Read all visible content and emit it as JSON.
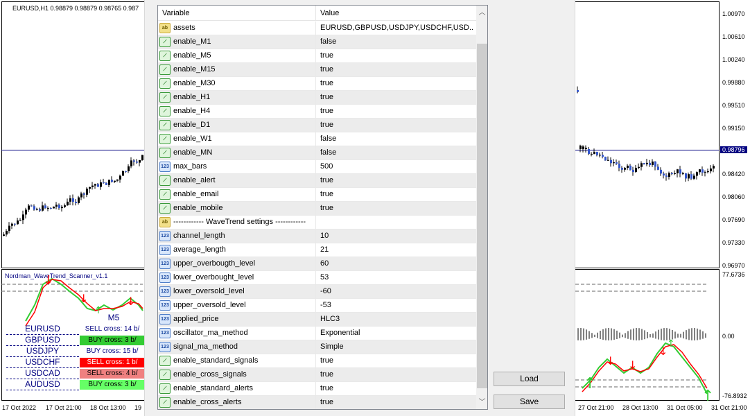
{
  "chart": {
    "title": "EURUSD,H1  0.98879 0.98879 0.98765 0.987",
    "indicator_title": "Nordman_WaveTrend_Scanner_v1.1",
    "price_labels": [
      "1.00970",
      "1.00610",
      "1.00240",
      "0.99880",
      "0.99510",
      "0.99150",
      "0.98796",
      "0.98420",
      "0.98060",
      "0.97690",
      "0.97330",
      "0.96970"
    ],
    "current_price": "0.98796",
    "indicator_labels": [
      "77.6736",
      "0.00",
      "-76.8932"
    ],
    "time_labels": [
      "17 Oct 2022",
      "17 Oct 21:00",
      "18 Oct 13:00",
      "19",
      "27 Oct 21:00",
      "28 Oct 13:00",
      "31 Oct 05:00",
      "31 Oct 21:00"
    ]
  },
  "scanner": {
    "timeframe": "M5",
    "rows": [
      {
        "symbol": "EURUSD",
        "signal": "SELL cross: 14 b/",
        "style": "plain"
      },
      {
        "symbol": "GBPUSD",
        "signal": "BUY cross: 3 b/",
        "style": "green"
      },
      {
        "symbol": "USDJPY",
        "signal": "BUY cross: 15 b/",
        "style": "plain"
      },
      {
        "symbol": "USDCHF",
        "signal": "SELL cross: 1 b/",
        "style": "red"
      },
      {
        "symbol": "USDCAD",
        "signal": "SELL cross: 4 b/",
        "style": "lightred"
      },
      {
        "symbol": "AUDUSD",
        "signal": "BUY cross: 3 b/",
        "style": "lightgreen"
      }
    ]
  },
  "colors": {
    "green": "#33cc33",
    "red": "#ff0000",
    "lightred": "#f08080",
    "lightgreen": "#66ff66"
  },
  "dialog": {
    "header": {
      "variable": "Variable",
      "value": "Value"
    },
    "rows": [
      {
        "name": "assets",
        "value": "EURUSD,GBPUSD,USDJPY,USDCHF,USD...",
        "icon": "ab"
      },
      {
        "name": "enable_M1",
        "value": "false",
        "icon": "bool"
      },
      {
        "name": "enable_M5",
        "value": "true",
        "icon": "bool"
      },
      {
        "name": "enable_M15",
        "value": "true",
        "icon": "bool"
      },
      {
        "name": "enable_M30",
        "value": "true",
        "icon": "bool"
      },
      {
        "name": "enable_H1",
        "value": "true",
        "icon": "bool"
      },
      {
        "name": "enable_H4",
        "value": "true",
        "icon": "bool"
      },
      {
        "name": "enable_D1",
        "value": "true",
        "icon": "bool"
      },
      {
        "name": "enable_W1",
        "value": "false",
        "icon": "bool"
      },
      {
        "name": "enable_MN",
        "value": "false",
        "icon": "bool"
      },
      {
        "name": "max_bars",
        "value": "500",
        "icon": "num"
      },
      {
        "name": "enable_alert",
        "value": "true",
        "icon": "bool"
      },
      {
        "name": "enable_email",
        "value": "true",
        "icon": "bool"
      },
      {
        "name": "enable_mobile",
        "value": "true",
        "icon": "bool"
      },
      {
        "name": "------------ WaveTrend settings ------------",
        "value": "",
        "icon": "ab"
      },
      {
        "name": "channel_length",
        "value": "10",
        "icon": "num"
      },
      {
        "name": "average_length",
        "value": "21",
        "icon": "num"
      },
      {
        "name": "upper_overbougth_level",
        "value": "60",
        "icon": "num"
      },
      {
        "name": "lower_overbought_level",
        "value": "53",
        "icon": "num"
      },
      {
        "name": "lower_oversold_level",
        "value": "-60",
        "icon": "num"
      },
      {
        "name": "upper_oversold_level",
        "value": "-53",
        "icon": "num"
      },
      {
        "name": "applied_price",
        "value": "HLC3",
        "icon": "num"
      },
      {
        "name": "oscillator_ma_method",
        "value": "Exponential",
        "icon": "num"
      },
      {
        "name": "signal_ma_method",
        "value": "Simple",
        "icon": "num"
      },
      {
        "name": "enable_standard_signals",
        "value": "true",
        "icon": "bool"
      },
      {
        "name": "enable_cross_signals",
        "value": "true",
        "icon": "bool"
      },
      {
        "name": "enable_standard_alerts",
        "value": "true",
        "icon": "bool"
      },
      {
        "name": "enable_cross_alerts",
        "value": "true",
        "icon": "bool"
      }
    ],
    "load_label": "Load",
    "save_label": "Save"
  }
}
